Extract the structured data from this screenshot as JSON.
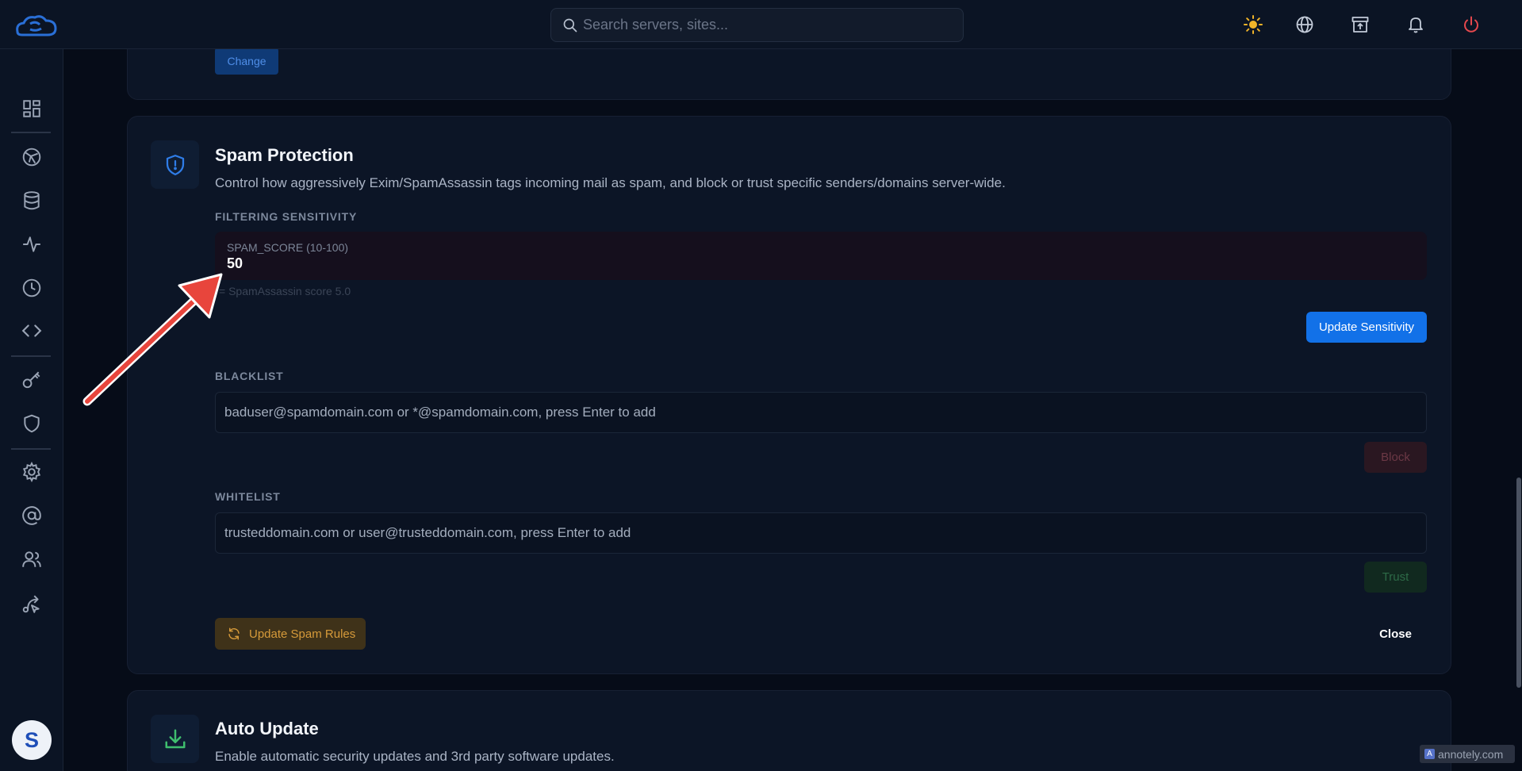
{
  "topbar": {
    "search_placeholder": "Search servers, sites..."
  },
  "top_section": {
    "change_label": "Change"
  },
  "spam_protection": {
    "title": "Spam Protection",
    "description": "Control how aggressively Exim/SpamAssassin tags incoming mail as spam, and block or trust specific senders/domains server-wide.",
    "filtering": {
      "label": "FILTERING SENSITIVITY",
      "field_label": "SPAM_SCORE (10-100)",
      "field_value": "50",
      "hint": "= SpamAssassin score 5.0",
      "update_label": "Update Sensitivity"
    },
    "blacklist": {
      "label": "BLACKLIST",
      "placeholder": "baduser@spamdomain.com or *@spamdomain.com, press Enter to add",
      "button_label": "Block"
    },
    "whitelist": {
      "label": "WHITELIST",
      "placeholder": "trusteddomain.com or user@trusteddomain.com, press Enter to add",
      "button_label": "Trust"
    },
    "update_rules_label": "Update Spam Rules",
    "close_label": "Close"
  },
  "auto_update": {
    "title": "Auto Update",
    "description": "Enable automatic security updates and 3rd party software updates."
  },
  "user": {
    "avatar_initial": "S"
  },
  "watermark": "annotely.com",
  "colors": {
    "background": "#060c18",
    "card": "#0c1526",
    "primary": "#1271e8",
    "block": "#6b3845",
    "trust": "#2d6a47",
    "warning": "#d69a3a",
    "annotation_arrow": "#e8453c"
  },
  "icons": {
    "topbar": [
      "sun-icon",
      "globe-icon",
      "archive-upload-icon",
      "bell-icon",
      "power-icon"
    ],
    "sidebar": [
      "dashboard-icon",
      "network-icon",
      "database-icon",
      "activity-icon",
      "clock-icon",
      "code-icon",
      "key-icon",
      "shield-icon",
      "settings-icon",
      "at-sign-icon",
      "users-icon",
      "route-icon"
    ]
  }
}
